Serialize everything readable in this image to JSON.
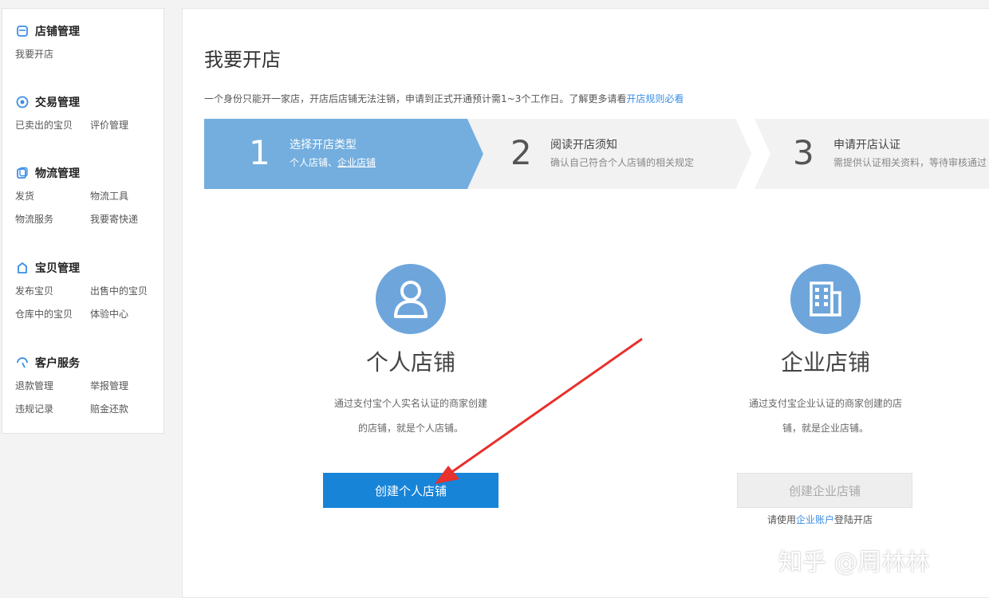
{
  "sidebar": {
    "groups": [
      {
        "title": "店铺管理",
        "icon": "store-icon",
        "links": [
          "我要开店"
        ]
      },
      {
        "title": "交易管理",
        "icon": "trade-icon",
        "links": [
          "已卖出的宝贝",
          "评价管理"
        ]
      },
      {
        "title": "物流管理",
        "icon": "logistics-icon",
        "links": [
          "发货",
          "物流工具",
          "物流服务",
          "我要寄快递"
        ]
      },
      {
        "title": "宝贝管理",
        "icon": "goods-icon",
        "links": [
          "发布宝贝",
          "出售中的宝贝",
          "仓库中的宝贝",
          "体验中心"
        ]
      },
      {
        "title": "客户服务",
        "icon": "service-icon",
        "links": [
          "退款管理",
          "举报管理",
          "违规记录",
          "赔金还款"
        ]
      }
    ]
  },
  "main": {
    "title": "我要开店",
    "notice": {
      "text": "一个身份只能开一家店，开店后店铺无法注销，申请到正式开通预计需1~3个工作日。了解更多请看",
      "link": "开店规则必看"
    },
    "steps": [
      {
        "num": "1",
        "title": "选择开店类型",
        "sub_a": "个人店铺、",
        "sub_b": "企业店铺"
      },
      {
        "num": "2",
        "title": "阅读开店须知",
        "sub": "确认自己符合个人店铺的相关规定"
      },
      {
        "num": "3",
        "title": "申请开店认证",
        "sub": "需提供认证相关资料，等待审核通过"
      }
    ],
    "personal": {
      "title": "个人店铺",
      "desc_line1": "通过支付宝个人实名认证的商家创建",
      "desc_line2": "的店铺，就是个人店铺。",
      "button": "创建个人店铺"
    },
    "enterprise": {
      "title": "企业店铺",
      "desc_line1": "通过支付宝企业认证的商家创建的店",
      "desc_line2": "铺，就是企业店铺。",
      "button": "创建企业店铺",
      "tip_pre": "请使用",
      "tip_link": "企业账户",
      "tip_post": "登陆开店"
    }
  },
  "watermark": "知乎 @周林林",
  "colors": {
    "step_active": "#73aedf",
    "step_inactive": "#f2f2f2",
    "primary_button": "#1784d8",
    "icon_circle": "#6ea6dc",
    "arrow": "#e8302c",
    "link": "#3a8ee6"
  }
}
